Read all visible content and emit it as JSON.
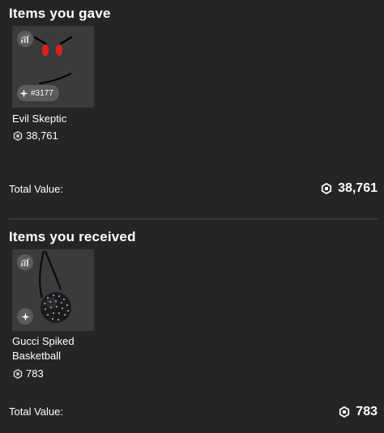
{
  "gave": {
    "title": "Items you gave",
    "item": {
      "name": "Evil Skeptic",
      "price": "38,761",
      "serial": "#3177",
      "icons": [
        "stats-icon",
        "limited-sparkle-icon"
      ]
    },
    "total_label": "Total Value:",
    "total_value": "38,761"
  },
  "received": {
    "title": "Items you received",
    "item": {
      "name": "Gucci Spiked Basketball",
      "price": "783",
      "icons": [
        "stats-icon",
        "limited-sparkle-icon"
      ]
    },
    "total_label": "Total Value:",
    "total_value": "783"
  },
  "colors": {
    "background": "#232527",
    "card": "#393b3d",
    "chip": "#5a5c5e",
    "eyes": "#d9211c"
  }
}
